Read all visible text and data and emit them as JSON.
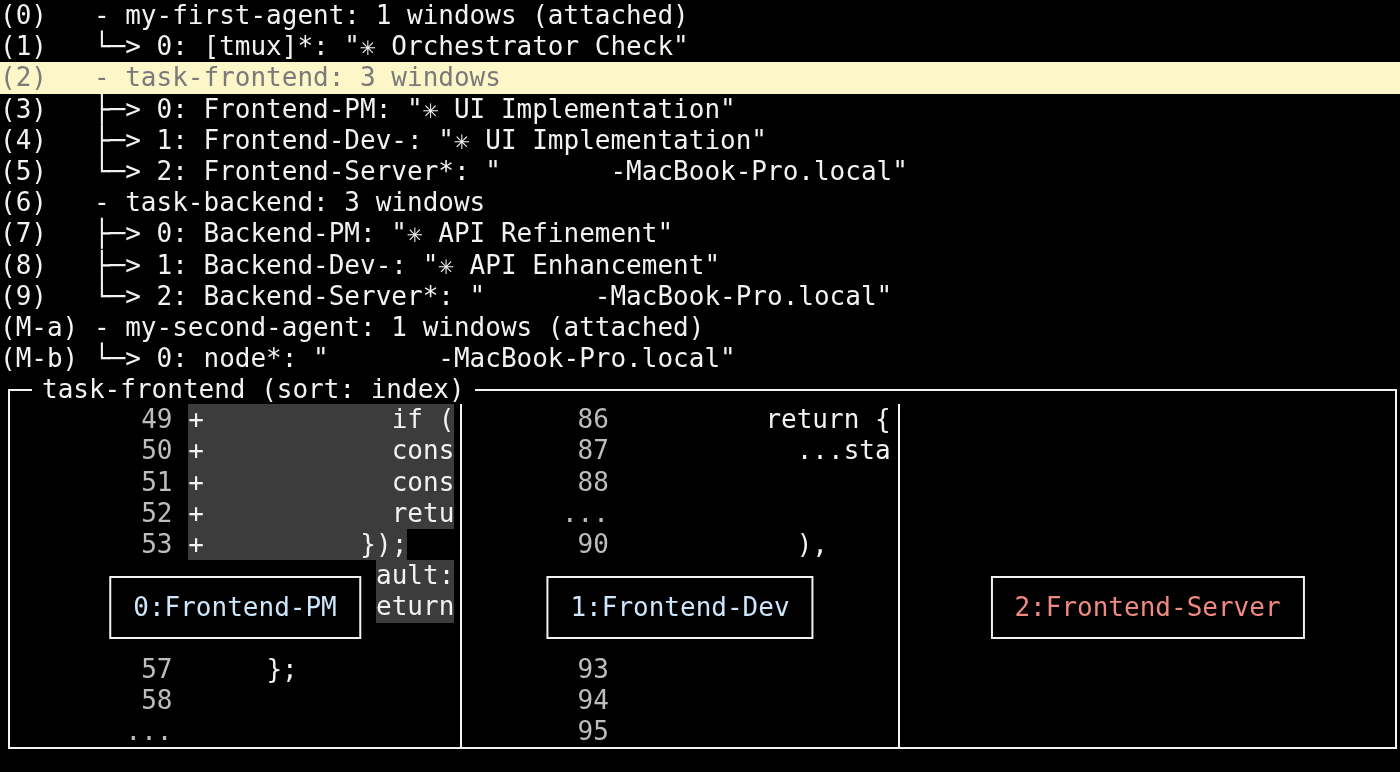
{
  "tree": [
    {
      "key": "(0)",
      "text": "- my-first-agent: 1 windows (attached)",
      "selected": false,
      "children": [
        {
          "key": "(1)",
          "text": "└─> 0: [tmux]*: \"✳ Orchestrator Check\"",
          "selected": false
        }
      ]
    },
    {
      "key": "(2)",
      "text": "- task-frontend: 3 windows",
      "selected": true,
      "children": [
        {
          "key": "(3)",
          "text": "├─> 0: Frontend-PM: \"✳ UI Implementation\"",
          "selected": false
        },
        {
          "key": "(4)",
          "text": "├─> 1: Frontend-Dev-: \"✳ UI Implementation\"",
          "selected": false
        },
        {
          "key": "(5)",
          "text": "└─> 2: Frontend-Server*: \"       -MacBook-Pro.local\"",
          "selected": false
        }
      ]
    },
    {
      "key": "(6)",
      "text": "- task-backend: 3 windows",
      "selected": false,
      "children": [
        {
          "key": "(7)",
          "text": "├─> 0: Backend-PM: \"✳ API Refinement\"",
          "selected": false
        },
        {
          "key": "(8)",
          "text": "├─> 1: Backend-Dev-: \"✳ API Enhancement\"",
          "selected": false
        },
        {
          "key": "(9)",
          "text": "└─> 2: Backend-Server*: \"       -MacBook-Pro.local\"",
          "selected": false
        }
      ]
    },
    {
      "key": "(M-a)",
      "text": "- my-second-agent: 1 windows (attached)",
      "selected": false,
      "children": [
        {
          "key": "(M-b)",
          "text": "└─> 0: node*: \"       -MacBook-Pro.local\"",
          "selected": false
        }
      ]
    }
  ],
  "preview": {
    "title": "task-frontend (sort: index)",
    "panes": [
      {
        "label": "0:Frontend-PM",
        "color": "#cde6fb",
        "lines": [
          {
            "kind": "code",
            "number": "49",
            "code": "+            if (",
            "highlighted": true
          },
          {
            "kind": "code",
            "number": "50",
            "code": "+            cons",
            "highlighted": true
          },
          {
            "kind": "code",
            "number": "51",
            "code": "+            cons",
            "highlighted": true
          },
          {
            "kind": "code",
            "number": "52",
            "code": "+            retu",
            "highlighted": true
          },
          {
            "kind": "code",
            "number": "53",
            "code": "+          });",
            "highlighted": true
          },
          {
            "kind": "code",
            "code": "            ault:",
            "highlighted": true
          },
          {
            "kind": "code",
            "code": "            eturn",
            "highlighted": true
          },
          {
            "kind": "blank"
          },
          {
            "kind": "code",
            "number": "57",
            "code": "     };",
            "highlighted": false
          },
          {
            "kind": "code",
            "number": "58"
          },
          {
            "kind": "code",
            "number": "..."
          }
        ]
      },
      {
        "label": "1:Frontend-Dev",
        "color": "#cde6fb",
        "lines": [
          {
            "kind": "code",
            "number": "86",
            "code": "         return {",
            "highlighted": false
          },
          {
            "kind": "code",
            "number": "87",
            "code": "           ...sta",
            "highlighted": false
          },
          {
            "kind": "code",
            "number": "88"
          },
          {
            "kind": "code",
            "number": "..."
          },
          {
            "kind": "code",
            "number": "90",
            "code": "           ),",
            "highlighted": false
          },
          {
            "kind": "blank"
          },
          {
            "kind": "blank"
          },
          {
            "kind": "blank"
          },
          {
            "kind": "code",
            "number": "93"
          },
          {
            "kind": "code",
            "number": "94"
          },
          {
            "kind": "code",
            "number": "95"
          }
        ]
      },
      {
        "label": "2:Frontend-Server",
        "color": "#f08a80"
      }
    ]
  }
}
